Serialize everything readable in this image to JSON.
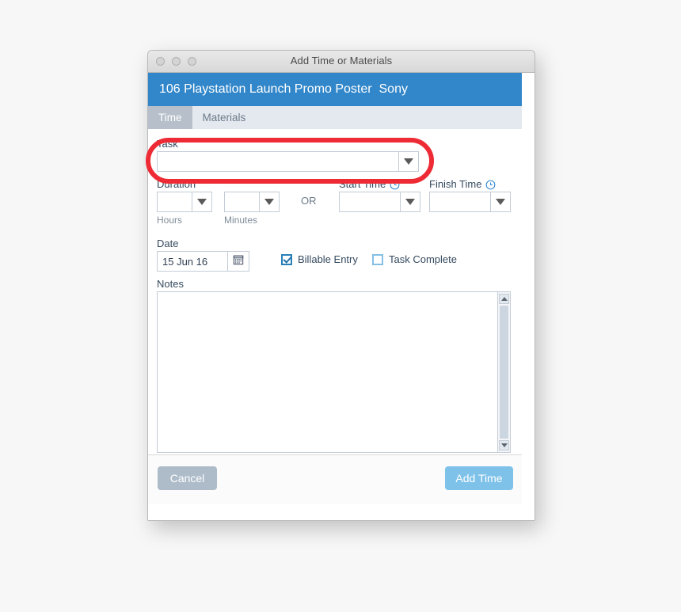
{
  "window": {
    "title": "Add Time or Materials",
    "traffic_lights": [
      "close-button",
      "minimize-button",
      "zoom-button"
    ]
  },
  "header": {
    "title": "106 Playstation Launch Promo Poster  Sony",
    "accent_color": "#3287ca"
  },
  "tabs": [
    {
      "label": "Time",
      "active": true
    },
    {
      "label": "Materials",
      "active": false
    }
  ],
  "form": {
    "task": {
      "label": "Task",
      "value": "",
      "placeholder": ""
    },
    "duration": {
      "label": "Duration",
      "hours": {
        "value": "",
        "sub_label": "Hours"
      },
      "minutes": {
        "value": "",
        "sub_label": "Minutes"
      },
      "or_text": "OR"
    },
    "start_time": {
      "label": "Start Time",
      "icon": "clock-icon",
      "value": ""
    },
    "finish_time": {
      "label": "Finish Time",
      "icon": "clock-icon",
      "value": ""
    },
    "date": {
      "label": "Date",
      "value": "15 Jun 16",
      "icon": "calendar-icon"
    },
    "billable_entry": {
      "label": "Billable Entry",
      "checked": true
    },
    "task_complete": {
      "label": "Task Complete",
      "checked": false
    },
    "notes": {
      "label": "Notes",
      "value": "",
      "placeholder": ""
    }
  },
  "footer": {
    "cancel_label": "Cancel",
    "add_label": "Add Time",
    "cancel_color": "#aebcca",
    "add_color": "#7ec2ea"
  },
  "annotation": {
    "shape": "rounded-rectangle-highlight",
    "target": "task-select",
    "color": "#ee2b35"
  }
}
